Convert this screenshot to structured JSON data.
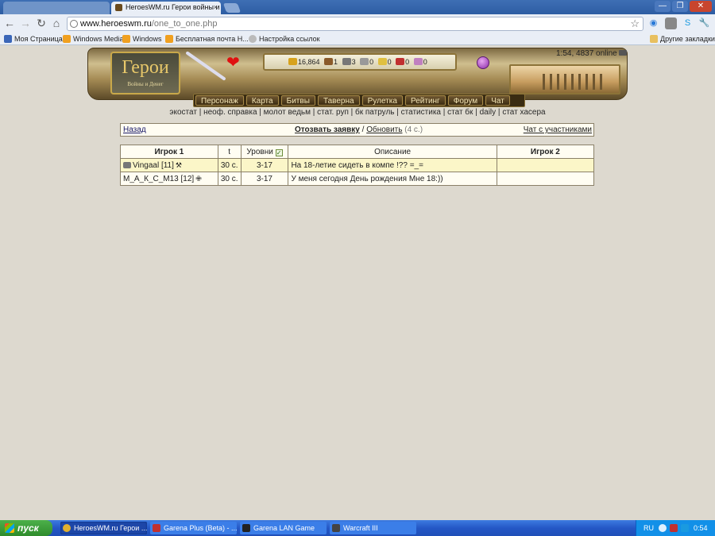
{
  "browser": {
    "active_tab_title": "HeroesWM.ru Герои войны и",
    "address_host": "www.heroeswm.ru",
    "address_path": "/one_to_one.php",
    "bookmarks": [
      "Моя Страница",
      "Windows Media",
      "Windows",
      "Бесплатная почта Н...",
      "Настройка ссылок"
    ],
    "other_bookmarks": "Другие закладки",
    "window_buttons": {
      "minimize": "—",
      "maximize": "❐",
      "close": "✕"
    }
  },
  "game": {
    "logo_title": "Герои",
    "logo_subtitle": "Войны и Денег",
    "clock": "1:54, 4837 online",
    "resources": [
      "16,864",
      "1",
      "3",
      "0",
      "0",
      "0",
      "0"
    ],
    "resource_colors": [
      "#d7a21c",
      "#8a5a2a",
      "#777777",
      "#999999",
      "#e0c040",
      "#c03030",
      "#c080c0"
    ],
    "menu": [
      "Персонаж",
      "Карта",
      "Битвы",
      "Таверна",
      "Рулетка",
      "Рейтинг",
      "Форум",
      "Чат"
    ],
    "sublinks": [
      "экостат",
      "неоф. справка",
      "молот ведьм",
      "стат. руп",
      "бк патруль",
      "статистика",
      "стат бк",
      "daily",
      "стат хасера"
    ]
  },
  "nav": {
    "back": "Назад",
    "withdraw": "Отозвать заявку",
    "slash": " / ",
    "refresh": "Обновить",
    "wait": " (4 с.)",
    "chat": "Чат с участниками"
  },
  "lobby": {
    "headers": {
      "player1": "Игрок 1",
      "time": "t",
      "levels": "Уровни",
      "description": "Описание",
      "player2": "Игрок 2"
    },
    "rows": [
      {
        "player1": "Vingaal [11]",
        "class_icon": "⚒",
        "time": "30 с.",
        "levels": "3-17",
        "description": "На 18-летие сидеть в компе !?? =_=",
        "player2": ""
      },
      {
        "player1": "М_А_К_С_М13 [12]",
        "class_icon": "✙",
        "time": "30 с.",
        "levels": "3-17",
        "description": "У меня сегодня День рождения Мне 18:))",
        "player2": ""
      }
    ]
  },
  "taskbar": {
    "start": "пуск",
    "tasks": [
      "HeroesWM.ru Герои ...",
      "Garena Plus (Beta) - ...",
      "Garena LAN Game",
      "Warcraft III"
    ],
    "lang": "RU",
    "time": "0:54"
  }
}
